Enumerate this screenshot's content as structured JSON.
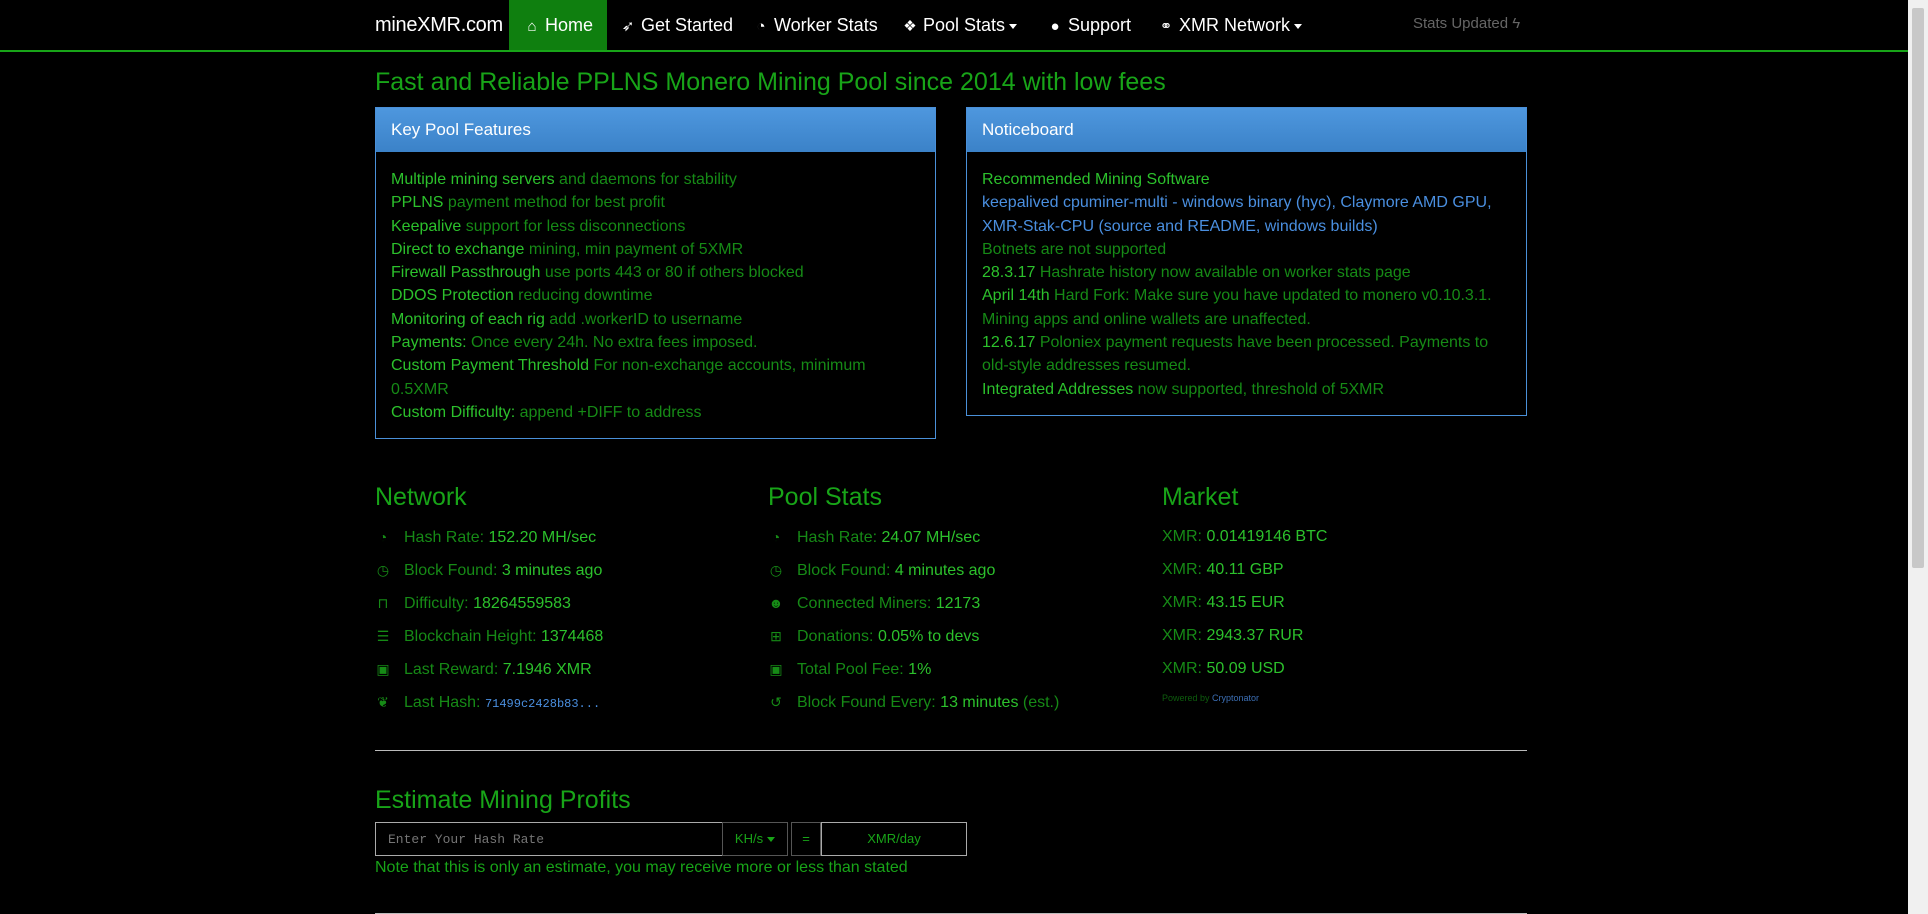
{
  "nav": {
    "brand": "mineXMR.com",
    "items": [
      {
        "label": "Home",
        "icon": "home-icon"
      },
      {
        "label": "Get Started",
        "icon": "rocket-icon"
      },
      {
        "label": "Worker Stats",
        "icon": "dashboard-icon"
      },
      {
        "label": "Pool Stats",
        "icon": "cubes-icon"
      },
      {
        "label": "Support",
        "icon": "comments-icon"
      },
      {
        "label": "XMR Network",
        "icon": "link-icon"
      }
    ],
    "stats_updated": "Stats Updated",
    "accent": "#18a418"
  },
  "headline": "Fast and Reliable PPLNS Monero Mining Pool since 2014 with low fees",
  "features": {
    "title": "Key Pool Features",
    "items": [
      {
        "strong": "Multiple mining servers",
        "rest": " and daemons for stability"
      },
      {
        "strong": "PPLNS",
        "rest": " payment method for best profit"
      },
      {
        "strong": "Keepalive",
        "rest": " support for less disconnections"
      },
      {
        "strong": "Direct to exchange",
        "rest": " mining, min payment of 5XMR"
      },
      {
        "strong": "Firewall Passthrough",
        "rest": " use ports 443 or 80 if others blocked"
      },
      {
        "strong": "DDOS Protection",
        "rest": " reducing downtime"
      },
      {
        "strong": "Monitoring of each rig",
        "rest": " add .workerID to username"
      },
      {
        "strong": "Payments:",
        "rest": " Once every 24h. No extra fees imposed."
      },
      {
        "strong": "Custom Payment Threshold",
        "rest": " For non-exchange accounts, minimum 0.5XMR"
      },
      {
        "strong": "Custom Difficulty:",
        "rest": " append +DIFF to address"
      }
    ]
  },
  "notice": {
    "title": "Noticeboard",
    "software_heading": "Recommended Mining Software",
    "sw_line1_a": "keepalived cpuminer-multi",
    "sw_line1_b": " - ",
    "sw_line1_c": "windows binary (hyc)",
    "sw_line1_d": ", ",
    "sw_line1_e": "Claymore AMD GPU",
    "sw_line1_f": ",",
    "sw_line2_a": "XMR-Stak-CPU",
    "sw_line2_b": " (",
    "sw_line2_c": "source and README",
    "sw_line2_d": ", ",
    "sw_line2_e": "windows builds",
    "sw_line2_f": ")",
    "botnets": "Botnets are not supported",
    "n1_strong": "28.3.17",
    "n1_rest": " Hashrate history now available on worker stats page",
    "n2_strong": "April 14th",
    "n2_rest": " Hard Fork: Make sure you have updated to monero v0.10.3.1. Mining apps and online wallets are unaffected.",
    "n3_strong": "12.6.17",
    "n3_rest": " Poloniex payment requests have been processed. Payments to old-style addresses resumed.",
    "n4_strong": "Integrated Addresses",
    "n4_rest": " now supported, threshold of 5XMR"
  },
  "network": {
    "title": "Network",
    "rows": [
      {
        "icon": "dashboard-icon",
        "label": "Hash Rate: ",
        "value": "152.20 MH/sec"
      },
      {
        "icon": "clock-icon",
        "label": "Block Found: ",
        "value": "3 minutes ago"
      },
      {
        "icon": "unlock-icon",
        "label": "Difficulty: ",
        "value": "18264559583"
      },
      {
        "icon": "bars-icon",
        "label": "Blockchain Height: ",
        "value": "1374468"
      },
      {
        "icon": "money-icon",
        "label": "Last Reward: ",
        "value": "7.1946 XMR"
      },
      {
        "icon": "paw-icon",
        "label": "Last Hash: ",
        "value": "71499c2428b83..."
      }
    ]
  },
  "pool": {
    "title": "Pool Stats",
    "rows": [
      {
        "icon": "dashboard-icon",
        "label": "Hash Rate: ",
        "value": "24.07 MH/sec"
      },
      {
        "icon": "clock-icon",
        "label": "Block Found: ",
        "value": "4 minutes ago"
      },
      {
        "icon": "users-icon",
        "label": "Connected Miners: ",
        "value": "12173"
      },
      {
        "icon": "gift-icon",
        "label": "Donations: ",
        "value": "0.05% to devs"
      },
      {
        "icon": "money-icon",
        "label": "Total Pool Fee: ",
        "value": "1%"
      },
      {
        "icon": "history-icon",
        "label": "Block Found Every: ",
        "value": "13 minutes",
        "suffix": " (est.)"
      }
    ]
  },
  "market": {
    "title": "Market",
    "rows": [
      {
        "label": "XMR: ",
        "value": "0.01419146 BTC"
      },
      {
        "label": "XMR: ",
        "value": "40.11 GBP"
      },
      {
        "label": "XMR: ",
        "value": "43.15 EUR"
      },
      {
        "label": "XMR: ",
        "value": "2943.37 RUR"
      },
      {
        "label": "XMR: ",
        "value": "50.09 USD"
      }
    ],
    "powered_by": "Powered by ",
    "powered_name": "Cryptonator"
  },
  "estimate": {
    "title": "Estimate Mining Profits",
    "placeholder": "Enter Your Hash Rate",
    "unit": "KH/s",
    "equals": "=",
    "output": "XMR/day",
    "note": "Note that this is only an estimate, you may receive more or less than stated"
  }
}
